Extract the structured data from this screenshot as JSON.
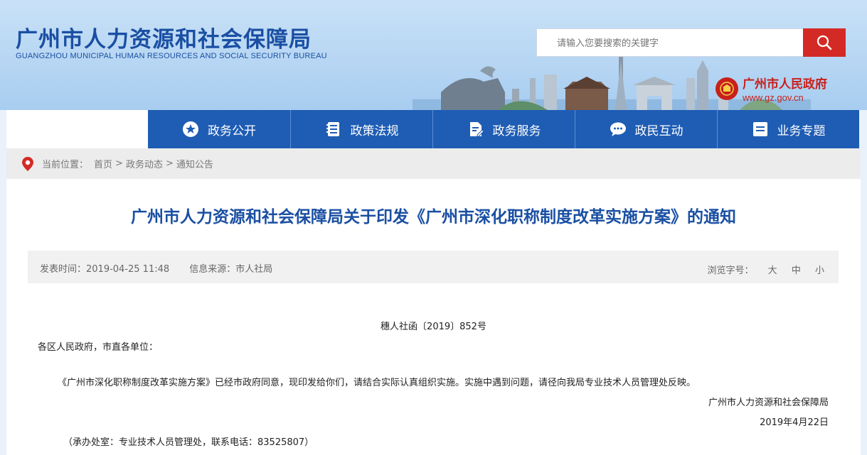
{
  "header": {
    "title_cn": "广州市人力资源和社会保障局",
    "title_en": "GUANGZHOU MUNICIPAL HUMAN RESOURCES AND SOCIAL SECURITY BUREAU",
    "search_placeholder": "请输入您要搜索的关键字",
    "gov_name": "广州市人民政府",
    "gov_domain": "www.gz.gov.cn"
  },
  "nav": {
    "items": [
      {
        "label": "政务公开",
        "icon": "star-icon"
      },
      {
        "label": "政策法规",
        "icon": "document-list-icon"
      },
      {
        "label": "政务服务",
        "icon": "file-edit-icon"
      },
      {
        "label": "政民互动",
        "icon": "chat-bubble-icon"
      },
      {
        "label": "业务专题",
        "icon": "menu-list-icon"
      }
    ]
  },
  "breadcrumb": {
    "prefix": "当前位置：",
    "items": [
      "首页",
      "政务动态",
      "通知公告"
    ],
    "separator": ">"
  },
  "article": {
    "title": "广州市人力资源和社会保障局关于印发《广州市深化职称制度改革实施方案》的通知",
    "publish_time": "发表时间：2019-04-25 11:48",
    "source": "信息来源：市人社局",
    "font_size_label": "浏览字号：",
    "font_sizes": [
      "大",
      "中",
      "小"
    ],
    "doc_number": "穗人社函〔2019〕852号",
    "salutation": "各区人民政府，市直各单位：",
    "body": "《广州市深化职称制度改革实施方案》已经市政府同意，现印发给你们，请结合实际认真组织实施。实施中遇到问题，请径向我局专业技术人员管理处反映。",
    "signature": "广州市人力资源和社会保障局",
    "date": "2019年4月22日",
    "contact": "（承办处室：专业技术人员管理处，联系电话：83525807）"
  },
  "colors": {
    "brand_blue": "#1f5db4",
    "title_blue": "#1a4fa3",
    "search_red": "#d42a25",
    "gov_red": "#c8201b"
  }
}
